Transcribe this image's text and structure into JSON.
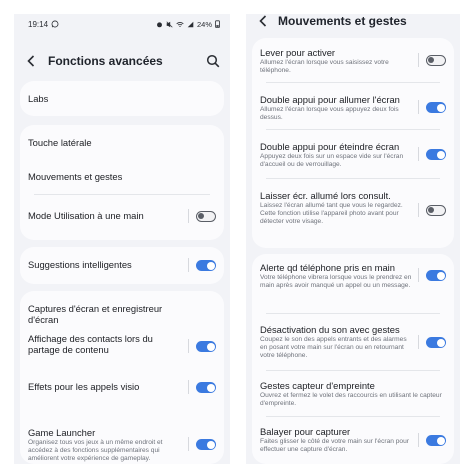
{
  "left": {
    "status": {
      "time": "19:14",
      "battery": "24%"
    },
    "header": {
      "title": "Fonctions avancées"
    },
    "items": [
      {
        "label": "Labs"
      },
      {
        "label": "Touche latérale"
      },
      {
        "label": "Mouvements et gestes"
      },
      {
        "label": "Mode Utilisation à une main",
        "toggle": false
      },
      {
        "label": "Suggestions intelligentes",
        "toggle": true
      },
      {
        "label": "Captures d'écran et enregistreur d'écran"
      },
      {
        "label": "Affichage des contacts lors du partage de contenu",
        "toggle": true
      },
      {
        "label": "Effets pour les appels visio",
        "toggle": true
      },
      {
        "label": "Game Launcher",
        "desc": "Organisez tous vos jeux à un même endroit et accédez à des fonctions supplémentaires qui améliorent votre expérience de gameplay.",
        "toggle": true
      }
    ]
  },
  "right": {
    "header": {
      "title": "Mouvements et gestes"
    },
    "items": [
      {
        "label": "Lever pour activer",
        "desc": "Allumez l'écran lorsque vous saisissez votre téléphone.",
        "toggle": false
      },
      {
        "label": "Double appui pour allumer l'écran",
        "desc": "Allumez l'écran lorsque vous appuyez deux fois dessus.",
        "toggle": true
      },
      {
        "label": "Double appui pour éteindre écran",
        "desc": "Appuyez deux fois sur un espace vide sur l'écran d'accueil ou de verrouillage.",
        "toggle": true
      },
      {
        "label": "Laisser écr. allumé lors consult.",
        "desc": "Laissez l'écran allumé tant que vous le regardez. Cette fonction utilise l'appareil photo avant pour détecter votre visage.",
        "toggle": false
      },
      {
        "label": "Alerte qd téléphone pris en main",
        "desc": "Votre téléphone vibrera lorsque vous le prendrez en main après avoir manqué un appel ou un message.",
        "toggle": true
      },
      {
        "label": "Désactivation du son avec gestes",
        "desc": "Coupez le son des appels entrants et des alarmes en posant votre main sur l'écran ou en retournant votre téléphone.",
        "toggle": true
      },
      {
        "label": "Gestes capteur d'empreinte",
        "desc": "Ouvrez et fermez le volet des raccourcis en utilisant le capteur d'empreinte."
      },
      {
        "label": "Balayer pour capturer",
        "desc": "Faites glisser le côté de votre main sur l'écran pour effectuer une capture d'écran.",
        "toggle": true
      }
    ]
  }
}
